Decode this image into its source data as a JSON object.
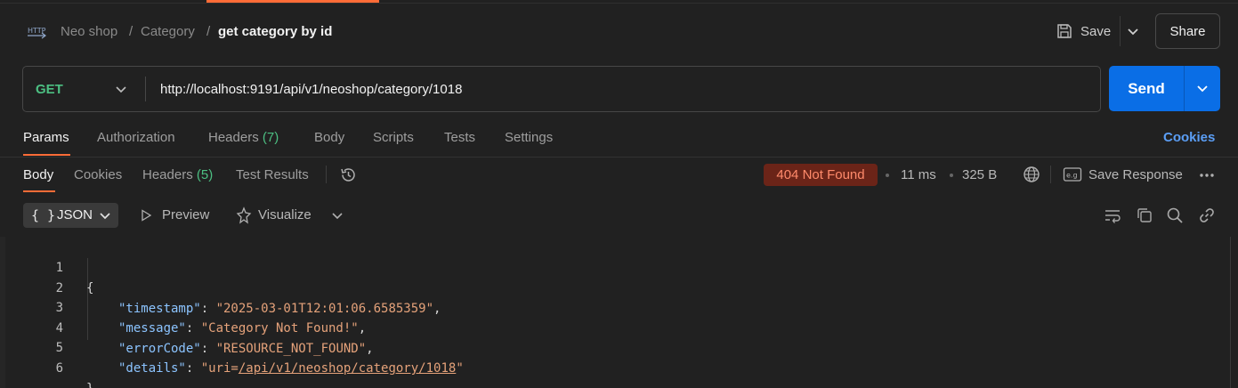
{
  "breadcrumb": {
    "workspace": "Neo shop",
    "folder": "Category",
    "request": "get category by id",
    "sep": "/"
  },
  "header": {
    "save_label": "Save",
    "share_label": "Share"
  },
  "request": {
    "method": "GET",
    "url": "http://localhost:9191/api/v1/neoshop/category/1018",
    "send_label": "Send"
  },
  "request_tabs": {
    "params": "Params",
    "authorization": "Authorization",
    "headers": "Headers",
    "headers_count": "(7)",
    "body": "Body",
    "scripts": "Scripts",
    "tests": "Tests",
    "settings": "Settings",
    "cookies": "Cookies"
  },
  "response_tabs": {
    "body": "Body",
    "cookies": "Cookies",
    "headers": "Headers",
    "headers_count": "(5)",
    "test_results": "Test Results"
  },
  "response_meta": {
    "status": "404 Not Found",
    "time": "11 ms",
    "size": "325 B",
    "save_response": "Save Response"
  },
  "toolbar": {
    "format": "JSON",
    "braces": "{ }",
    "preview": "Preview",
    "visualize": "Visualize"
  },
  "code": {
    "line_numbers": [
      "1",
      "2",
      "3",
      "4",
      "5",
      "6"
    ],
    "open": "{",
    "close": "}",
    "fields": [
      {
        "key": "\"timestamp\"",
        "value": "\"2025-03-01T12:01:06.6585359\""
      },
      {
        "key": "\"message\"",
        "value": "\"Category Not Found!\""
      },
      {
        "key": "\"errorCode\"",
        "value": "\"RESOURCE_NOT_FOUND\""
      },
      {
        "key": "\"details\"",
        "value_prefix": "\"uri=",
        "value_link": "/api/v1/neoshop/category/1018",
        "value_suffix": "\""
      }
    ]
  },
  "colors": {
    "accent": "#ff6c37",
    "send": "#0a6ee6",
    "method": "#4cbf82",
    "status_bg": "#6b2418",
    "status_fg": "#ff8a6b"
  }
}
